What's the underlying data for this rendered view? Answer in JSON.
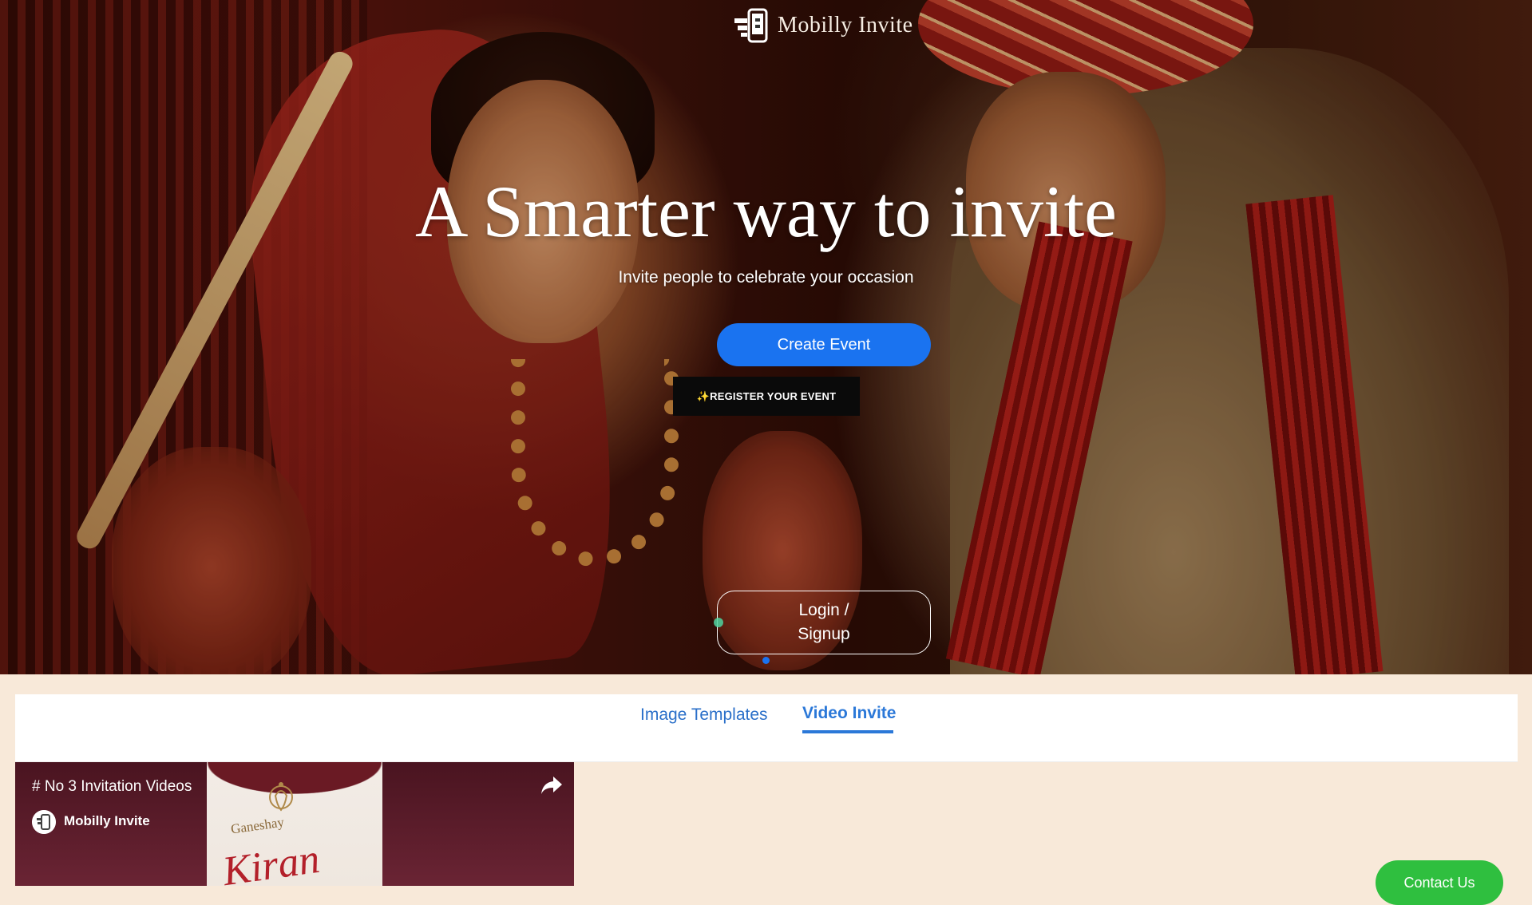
{
  "brand": {
    "name": "Mobilly Invite"
  },
  "hero": {
    "headline": "A Smarter way to invite",
    "subheadline": "Invite people to celebrate your occasion",
    "create_event_label": "Create Event",
    "register_label": "✨REGISTER YOUR EVENT",
    "login_label": "Login / Signup"
  },
  "tabs": [
    {
      "label": "Image Templates",
      "active": false
    },
    {
      "label": "Video Invite",
      "active": true
    }
  ],
  "video": {
    "title": "# No 3 Invitation Videos",
    "channel": "Mobilly Invite",
    "thumb_line1": "Ganeshay",
    "thumb_name": "Kiran"
  },
  "contact_label": "Contact Us",
  "colors": {
    "primary": "#1a73f0",
    "tab_active": "#2b78d8",
    "page_bg": "#f8e9d9",
    "contact": "#2fbf3f"
  }
}
